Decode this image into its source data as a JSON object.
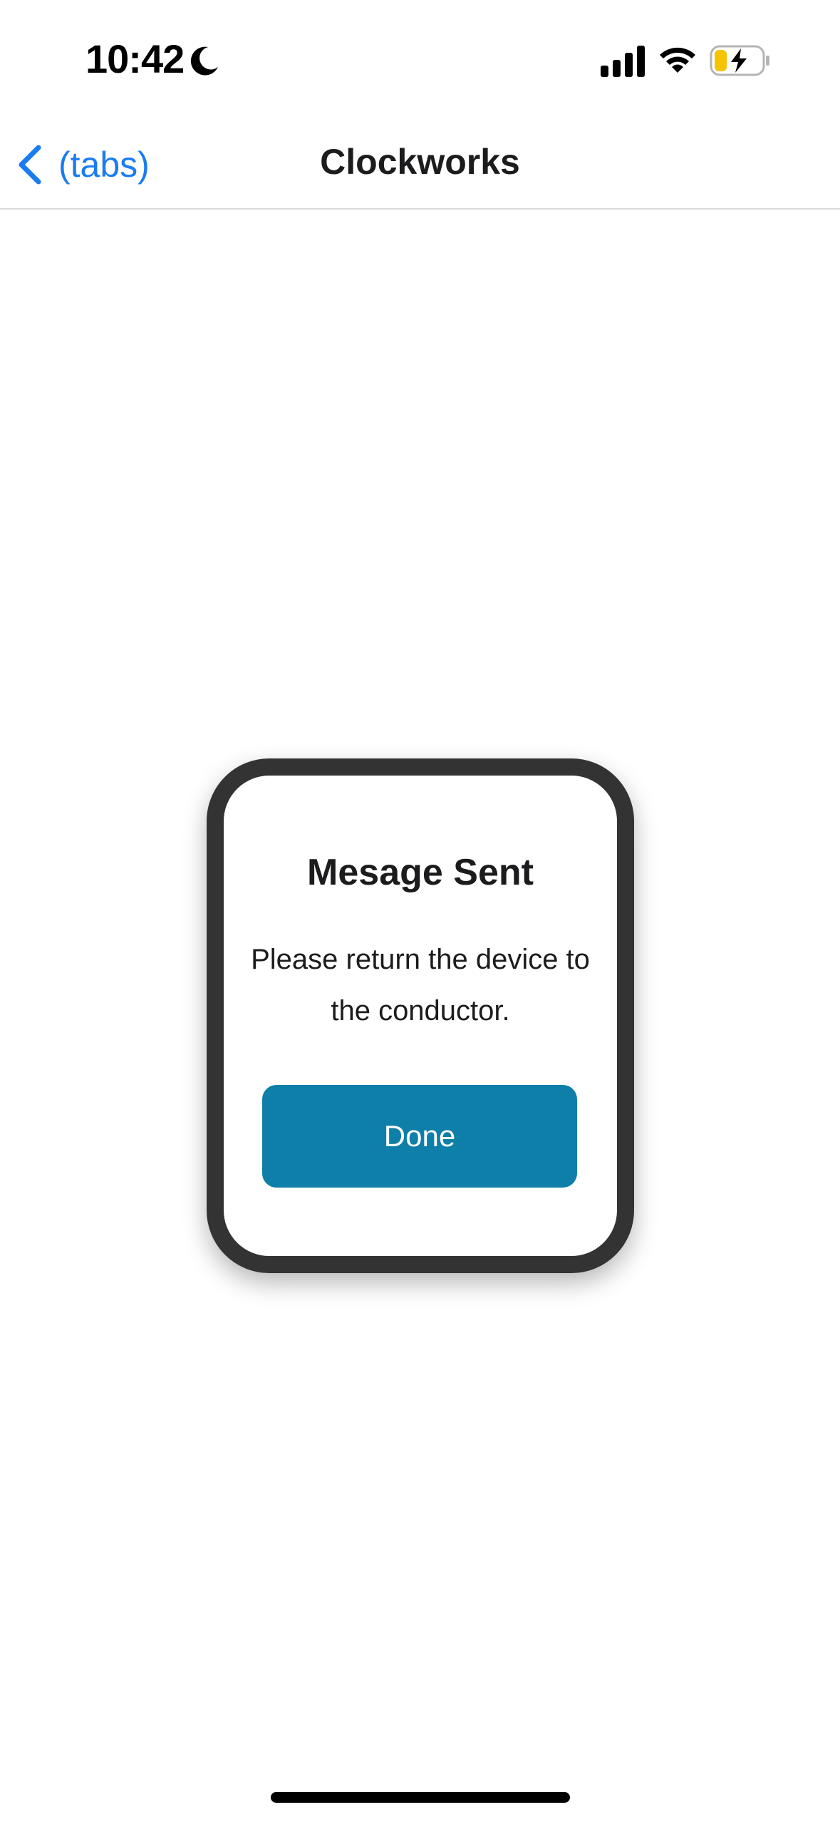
{
  "status_bar": {
    "time": "10:42",
    "focus_icon": "moon-icon",
    "signal_icon": "cellular-signal-icon",
    "wifi_icon": "wifi-icon",
    "battery_icon": "battery-charging-icon",
    "battery_level_fraction": 0.25,
    "battery_color": "#f5c400"
  },
  "nav": {
    "back_label": "(tabs)",
    "title": "Clockworks",
    "accent_color": "#1a7cf0"
  },
  "modal": {
    "title": "Mesage Sent",
    "message": "Please return the device to the conductor.",
    "done_label": "Done",
    "button_color": "#0e7fa8",
    "frame_color": "#333333"
  }
}
